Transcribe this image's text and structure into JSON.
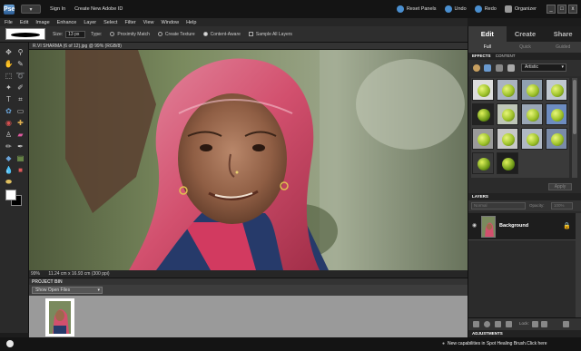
{
  "titlebar": {
    "sign_in": "Sign In",
    "create_id": "Create New Adobe ID",
    "reset_panels": "Reset Panels",
    "undo": "Undo",
    "redo": "Redo",
    "organizer": "Organizer",
    "minimize": "_",
    "restore": "□",
    "close": "x"
  },
  "menubar": [
    "File",
    "Edit",
    "Image",
    "Enhance",
    "Layer",
    "Select",
    "Filter",
    "View",
    "Window",
    "Help"
  ],
  "options": {
    "size_label": "Size:",
    "size_value": "13 px",
    "type_label": "Type:",
    "types": [
      "Proximity Match",
      "Create Texture",
      "Content-Aware"
    ],
    "selected_type_index": 2,
    "sample_all_layers": "Sample All Layers"
  },
  "document": {
    "tab_label": "R.VI SHARMA (6 of 12).jpg @ 99% (RGB/8)",
    "zoom": "99%",
    "status_text": "11.24 cm x 16.93 cm (300 ppi)"
  },
  "project_bin": {
    "title": "PROJECT BIN",
    "selector_value": "Show Open Files"
  },
  "panel": {
    "mode_tabs": [
      "Edit",
      "Create",
      "Share"
    ],
    "active_mode": "Edit",
    "sub_tabs": [
      "Full",
      "Quick",
      "Guided"
    ],
    "active_sub": "Full",
    "effects": {
      "tab_effects": "EFFECTS",
      "tab_content": "CONTENT",
      "category": "Artistic",
      "apply_label": "Apply"
    },
    "layers": {
      "title": "LAYERS",
      "blend_mode": "Normal",
      "opacity_label": "Opacity:",
      "opacity_value": "100%",
      "layer_name": "Background",
      "lock_label": "Lock:"
    },
    "adjustments_title": "ADJUSTMENTS"
  },
  "bottom": {
    "tip": "New capabilities in Spot Healing Brush.Click here"
  },
  "colors": {
    "foreground": "#ffffff",
    "background": "#000000",
    "accent": "#4a8fd0"
  }
}
